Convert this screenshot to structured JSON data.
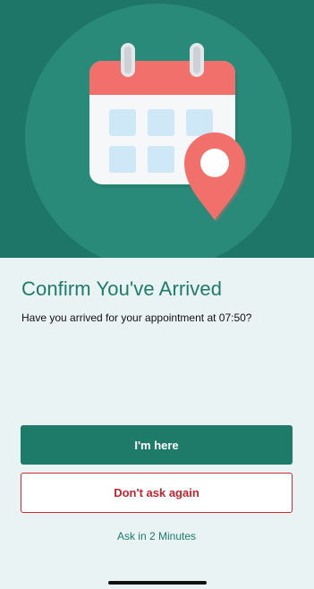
{
  "hero": {
    "illustration_icon": "calendar-with-location-pin-icon",
    "colors": {
      "background": "#1d7667",
      "circle": "#2a8a7a",
      "calendar_header": "#f2706c",
      "calendar_body": "#f5f7f8",
      "calendar_cell": "#cfe8f7",
      "pin": "#f2706c"
    }
  },
  "content": {
    "title": "Confirm You've Arrived",
    "message": "Have you arrived for your appointment at 07:50?"
  },
  "actions": {
    "primary_label": "I'm here",
    "secondary_label": "Don't ask again",
    "tertiary_label": "Ask in 2 Minutes"
  },
  "colors": {
    "accent": "#1f7b69",
    "danger": "#c8222d",
    "page_background": "#e9f3f3"
  }
}
